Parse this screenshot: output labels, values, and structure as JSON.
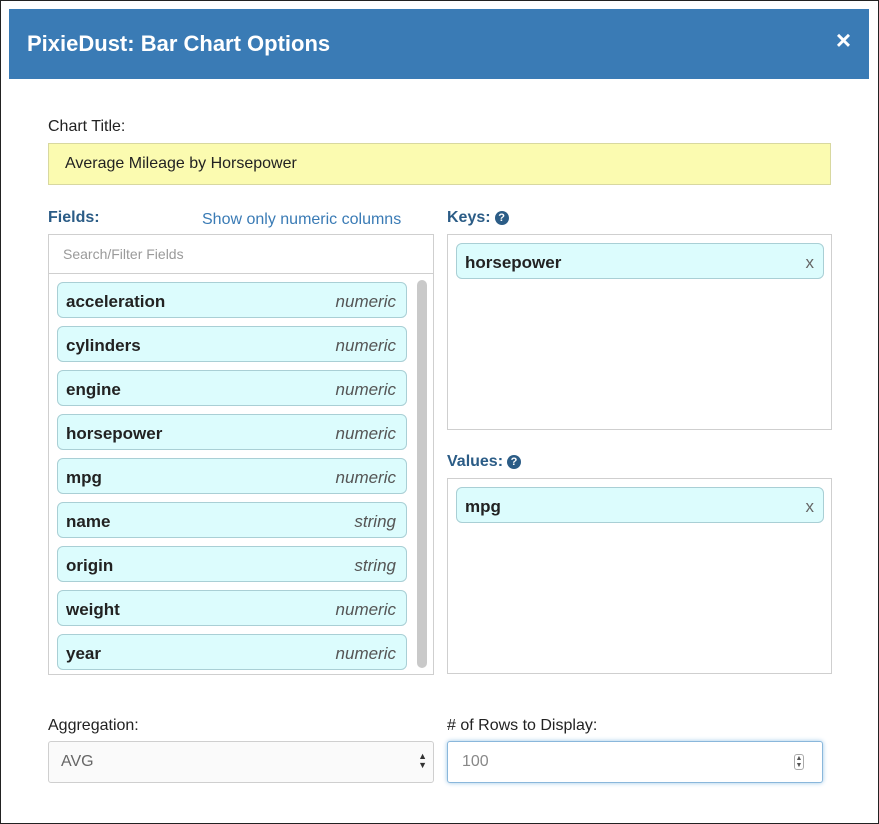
{
  "dialog": {
    "title": "PixieDust: Bar Chart Options"
  },
  "chart_title": {
    "label": "Chart Title:",
    "value": "Average Mileage by Horsepower"
  },
  "fields": {
    "label": "Fields:",
    "filter_link": "Show only numeric columns",
    "search_placeholder": "Search/Filter Fields",
    "items": [
      {
        "name": "acceleration",
        "type": "numeric"
      },
      {
        "name": "cylinders",
        "type": "numeric"
      },
      {
        "name": "engine",
        "type": "numeric"
      },
      {
        "name": "horsepower",
        "type": "numeric"
      },
      {
        "name": "mpg",
        "type": "numeric"
      },
      {
        "name": "name",
        "type": "string"
      },
      {
        "name": "origin",
        "type": "string"
      },
      {
        "name": "weight",
        "type": "numeric"
      },
      {
        "name": "year",
        "type": "numeric"
      }
    ]
  },
  "keys": {
    "label": "Keys:",
    "items": [
      "horsepower"
    ]
  },
  "values": {
    "label": "Values:",
    "items": [
      "mpg"
    ]
  },
  "aggregation": {
    "label": "Aggregation:",
    "selected": "AVG"
  },
  "rows": {
    "label": "# of Rows to Display:",
    "value": "100"
  },
  "icons": {
    "close": "×",
    "remove": "x",
    "help": "?"
  },
  "colors": {
    "header": "#3a7bb5",
    "chip_bg": "#dcfcfd",
    "title_input_bg": "#fbfbb0",
    "section_label": "#2b5c86"
  }
}
